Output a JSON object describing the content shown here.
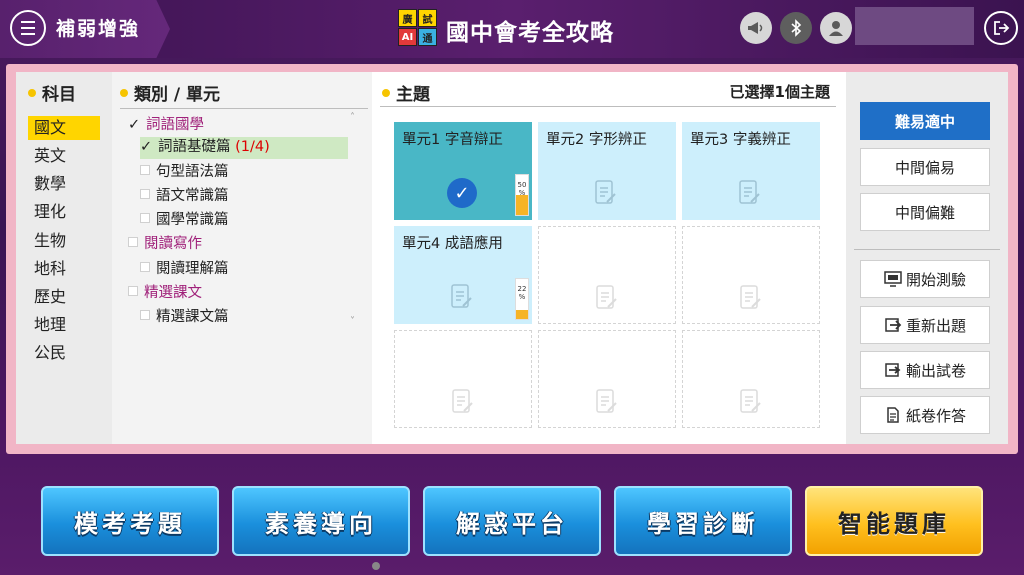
{
  "header": {
    "section_title": "補弱增強",
    "logo_chars": [
      "廣",
      "試",
      "AI",
      "通"
    ],
    "app_title": "國中會考全攻略"
  },
  "subjects": {
    "heading": "科目",
    "items": [
      "國文",
      "英文",
      "數學",
      "理化",
      "生物",
      "地科",
      "歷史",
      "地理",
      "公民"
    ],
    "active_index": 0
  },
  "units": {
    "heading": "類別 / 單元",
    "rows": [
      {
        "label": "詞語國學",
        "level": "parent",
        "checked": true
      },
      {
        "label": "詞語基礎篇",
        "count": "(1/4)",
        "level": "child",
        "checked": true,
        "selected": true
      },
      {
        "label": "句型語法篇",
        "level": "child",
        "checked": false
      },
      {
        "label": "語文常識篇",
        "level": "child",
        "checked": false
      },
      {
        "label": "國學常識篇",
        "level": "child",
        "checked": false
      },
      {
        "label": "閱讀寫作",
        "level": "parent",
        "checked": false
      },
      {
        "label": "閱讀理解篇",
        "level": "child",
        "checked": false
      },
      {
        "label": "精選課文",
        "level": "parent",
        "checked": false
      },
      {
        "label": "精選課文篇",
        "level": "child",
        "checked": false
      }
    ]
  },
  "topics": {
    "heading": "主題",
    "selected_summary": "已選擇1個主題",
    "tiles": [
      {
        "name": "單元1 字音辯正",
        "state": "active",
        "progress_label": "50\n%",
        "progress": 0.5
      },
      {
        "name": "單元2 字形辨正",
        "state": "filled"
      },
      {
        "name": "單元3 字義辨正",
        "state": "filled"
      },
      {
        "name": "單元4 成語應用",
        "state": "filled",
        "progress_label": "22\n%",
        "progress": 0.22
      }
    ]
  },
  "difficulty": {
    "options": [
      "難易適中",
      "中間偏易",
      "中間偏難"
    ],
    "active_index": 0
  },
  "actions": [
    {
      "label": "開始測驗",
      "icon": "monitor-icon"
    },
    {
      "label": "重新出題",
      "icon": "redo-icon"
    },
    {
      "label": "輸出試卷",
      "icon": "export-icon"
    },
    {
      "label": "紙卷作答",
      "icon": "paper-icon"
    }
  ],
  "bottom_nav": [
    "模考考題",
    "素養導向",
    "解惑平台",
    "學習診斷",
    "智能題庫"
  ],
  "colors": {
    "accent_blue": "#1f6fc7",
    "active_subject": "#ffd500",
    "active_tile": "#49b7c6",
    "tile_bg": "#cdeffc",
    "parent_unit": "#a0217a"
  }
}
